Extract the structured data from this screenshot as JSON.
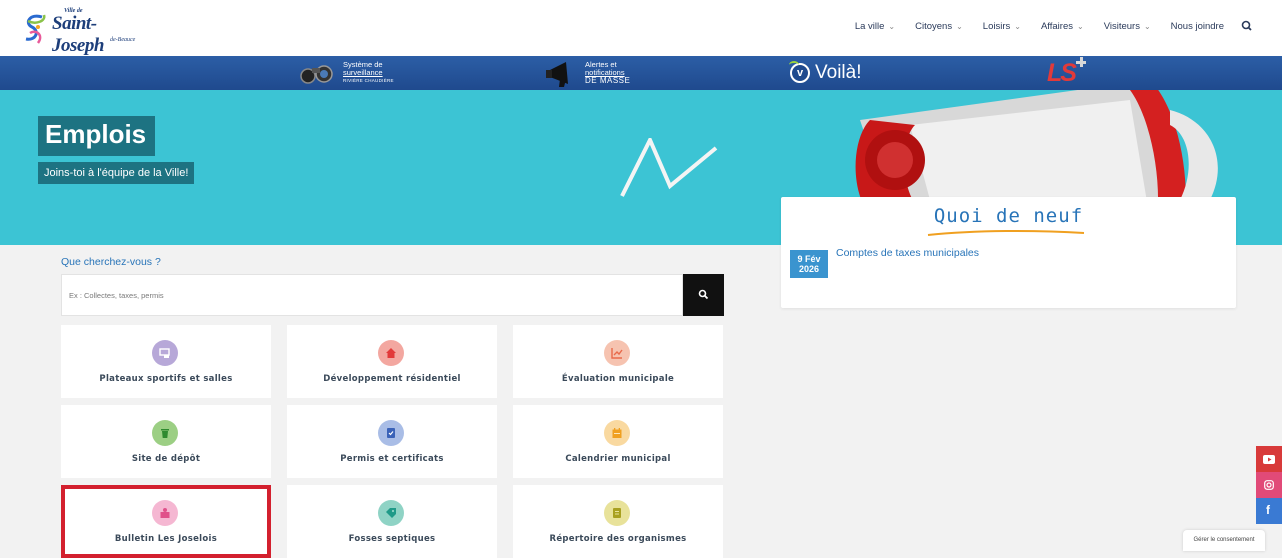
{
  "logo": {
    "top": "Ville de",
    "name": "Saint-Joseph",
    "sub": "de-Beauce"
  },
  "nav": {
    "items": [
      {
        "label": "La ville",
        "has_menu": true
      },
      {
        "label": "Citoyens",
        "has_menu": true
      },
      {
        "label": "Loisirs",
        "has_menu": true
      },
      {
        "label": "Affaires",
        "has_menu": true
      },
      {
        "label": "Visiteurs",
        "has_menu": true
      },
      {
        "label": "Nous joindre",
        "has_menu": false
      }
    ],
    "chevron": "⌄",
    "search_icon": "search-icon"
  },
  "banner": {
    "surveillance": {
      "line1": "Système de",
      "line2": "surveillance",
      "line3": "RIVIÈRE CHAUDIÈRE"
    },
    "alertes": {
      "line1": "Alertes et",
      "line2": "notifications",
      "line3": "DE MASSE"
    },
    "voila": {
      "check": "v",
      "text": "Voilà!"
    },
    "ls": "LS"
  },
  "hero": {
    "title": "Emplois",
    "subtitle": "Joins-toi à l'équipe de la Ville!"
  },
  "news": {
    "title": "Quoi de neuf",
    "items": [
      {
        "day_month": "9 Fév",
        "year": "2026",
        "title": "Comptes de taxes municipales"
      }
    ]
  },
  "search": {
    "label": "Que cherchez-vous ?",
    "placeholder": "Ex : Collectes, taxes, permis",
    "value": ""
  },
  "tiles": [
    {
      "label": "Plateaux sportifs et salles",
      "icon": "sports-venue-icon",
      "color": "#b7a8d8",
      "selected": false
    },
    {
      "label": "Développement résidentiel",
      "icon": "home-icon",
      "color": "#f3a7a0",
      "selected": false
    },
    {
      "label": "Évaluation municipale",
      "icon": "chart-icon",
      "color": "#f6c3b0",
      "selected": false
    },
    {
      "label": "Site de dépôt",
      "icon": "trash-icon",
      "color": "#9ccf84",
      "selected": false
    },
    {
      "label": "Permis et certificats",
      "icon": "certificate-icon",
      "color": "#a9bde6",
      "selected": false
    },
    {
      "label": "Calendrier municipal",
      "icon": "calendar-icon",
      "color": "#f9d9a0",
      "selected": false
    },
    {
      "label": "Bulletin Les Joselois",
      "icon": "newsletter-icon",
      "color": "#f5b7d2",
      "selected": true
    },
    {
      "label": "Fosses septiques",
      "icon": "septic-tag-icon",
      "color": "#8fd3c5",
      "selected": false
    },
    {
      "label": "Répertoire des organismes",
      "icon": "directory-icon",
      "color": "#e8e29a",
      "selected": false
    }
  ],
  "social": {
    "youtube": {
      "icon": "youtube-icon",
      "color": "#d83a3a"
    },
    "instagram": {
      "icon": "instagram-icon",
      "color": "#e14a78"
    },
    "facebook": {
      "icon": "facebook-icon",
      "color": "#3a7ad3",
      "glyph": "f"
    }
  },
  "consent": "Gérer le consentement"
}
